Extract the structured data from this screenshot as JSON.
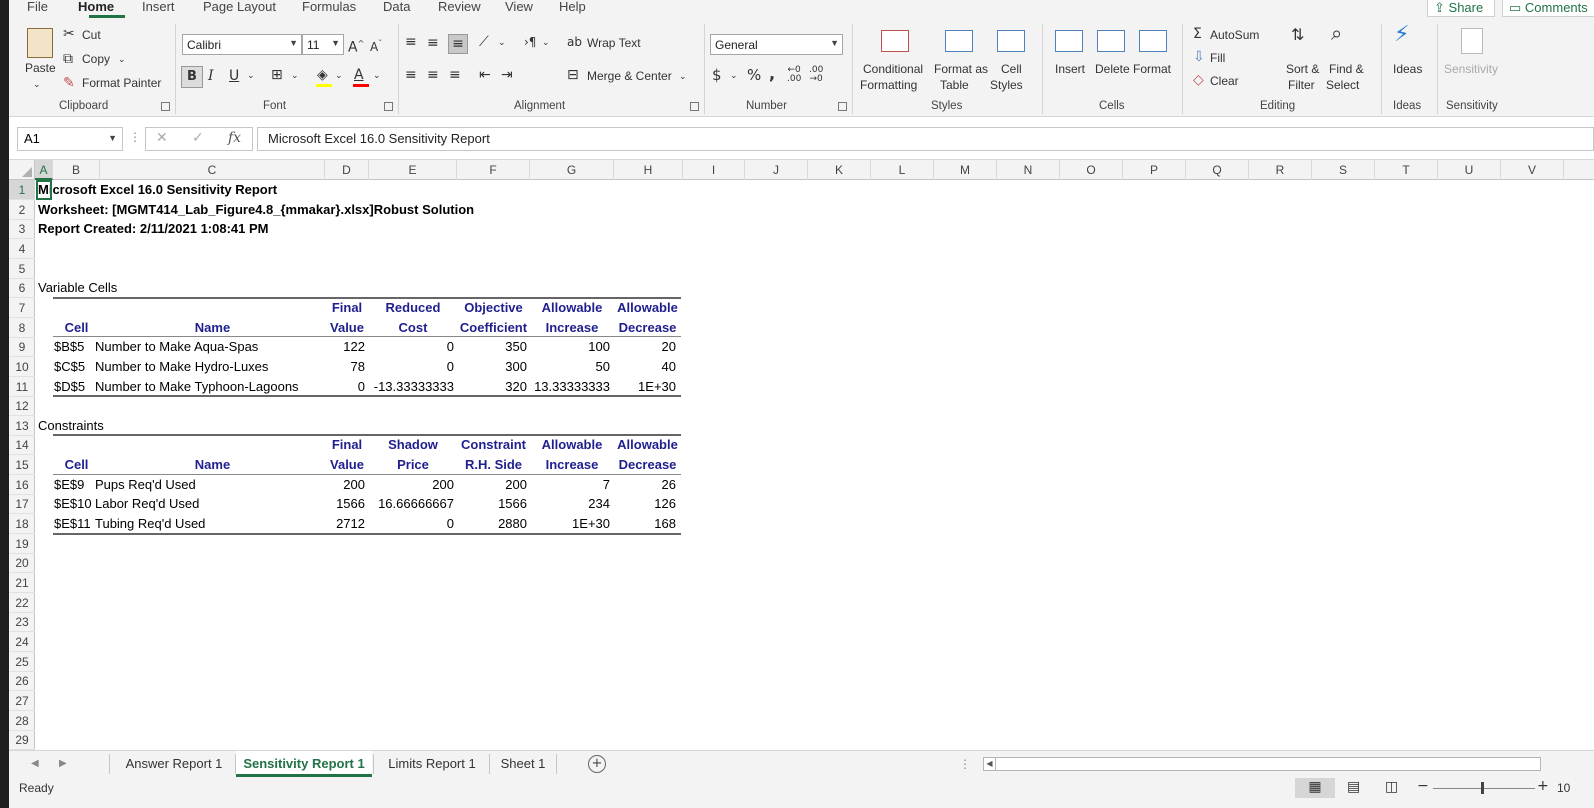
{
  "menu": {
    "tabs": [
      "File",
      "Home",
      "Insert",
      "Page Layout",
      "Formulas",
      "Data",
      "Review",
      "View",
      "Help"
    ],
    "share_label": "Share",
    "comments_label": "Comments"
  },
  "ribbon": {
    "clipboard": {
      "paste": "Paste",
      "cut": "Cut",
      "copy": "Copy",
      "format_painter": "Format Painter",
      "group": "Clipboard"
    },
    "font": {
      "name": "Calibri",
      "size": "11",
      "group": "Font"
    },
    "alignment": {
      "wrap_text": "Wrap Text",
      "merge_center": "Merge & Center",
      "group": "Alignment"
    },
    "number": {
      "format": "General",
      "group": "Number"
    },
    "styles": {
      "conditional_1": "Conditional",
      "conditional_2": "Formatting",
      "table_1": "Format as",
      "table_2": "Table",
      "cell_1": "Cell",
      "cell_2": "Styles",
      "group": "Styles"
    },
    "cells": {
      "insert": "Insert",
      "delete": "Delete",
      "format": "Format",
      "group": "Cells"
    },
    "editing": {
      "autosum": "AutoSum",
      "fill": "Fill",
      "clear": "Clear",
      "sort_1": "Sort &",
      "sort_2": "Filter",
      "find_1": "Find &",
      "find_2": "Select",
      "group": "Editing"
    },
    "ideas": {
      "label": "Ideas",
      "group": "Ideas"
    },
    "sensitivity": {
      "label": "Sensitivity",
      "group": "Sensitivity"
    }
  },
  "formula_bar": {
    "name_box": "A1",
    "content": "Microsoft Excel 16.0 Sensitivity Report"
  },
  "columns": [
    "A",
    "B",
    "C",
    "D",
    "E",
    "F",
    "G",
    "H",
    "I",
    "J",
    "K",
    "L",
    "M",
    "N",
    "O",
    "P",
    "Q",
    "R",
    "S",
    "T",
    "U",
    "V"
  ],
  "rows": [
    "1",
    "2",
    "3",
    "4",
    "5",
    "6",
    "7",
    "8",
    "9",
    "10",
    "11",
    "12",
    "13",
    "14",
    "15",
    "16",
    "17",
    "18",
    "19",
    "20",
    "21",
    "22",
    "23",
    "24",
    "25",
    "26",
    "27",
    "28",
    "29"
  ],
  "report": {
    "title": "Microsoft Excel 16.0 Sensitivity Report",
    "worksheet": "Worksheet: [MGMT414_Lab_Figure4.8_{mmakar}.xlsx]Robust Solution",
    "created": "Report Created: 2/11/2021 1:08:41 PM",
    "variable_section": "Variable Cells",
    "variable_headers_top": [
      "Final",
      "Reduced",
      "Objective",
      "Allowable",
      "Allowable"
    ],
    "variable_headers_bottom": [
      "Cell",
      "Name",
      "Value",
      "Cost",
      "Coefficient",
      "Increase",
      "Decrease"
    ],
    "variable_rows": [
      [
        "$B$5",
        "Number to Make Aqua-Spas",
        "122",
        "0",
        "350",
        "100",
        "20"
      ],
      [
        "$C$5",
        "Number to Make Hydro-Luxes",
        "78",
        "0",
        "300",
        "50",
        "40"
      ],
      [
        "$D$5",
        "Number to Make Typhoon-Lagoons",
        "0",
        "-13.33333333",
        "320",
        "13.33333333",
        "1E+30"
      ]
    ],
    "constraint_section": "Constraints",
    "constraint_headers_top": [
      "Final",
      "Shadow",
      "Constraint",
      "Allowable",
      "Allowable"
    ],
    "constraint_headers_bottom": [
      "Cell",
      "Name",
      "Value",
      "Price",
      "R.H. Side",
      "Increase",
      "Decrease"
    ],
    "constraint_rows": [
      [
        "$E$9",
        "Pups Req'd Used",
        "200",
        "200",
        "200",
        "7",
        "26"
      ],
      [
        "$E$10",
        "Labor Req'd Used",
        "1566",
        "16.66666667",
        "1566",
        "234",
        "126"
      ],
      [
        "$E$11",
        "Tubing Req'd Used",
        "2712",
        "0",
        "2880",
        "1E+30",
        "168"
      ]
    ]
  },
  "sheets": {
    "tabs": [
      "Answer Report 1",
      "Sensitivity Report 1",
      "Limits Report 1",
      "Sheet 1"
    ],
    "active": "Sensitivity Report 1"
  },
  "status": {
    "ready": "Ready",
    "zoom": "10"
  }
}
